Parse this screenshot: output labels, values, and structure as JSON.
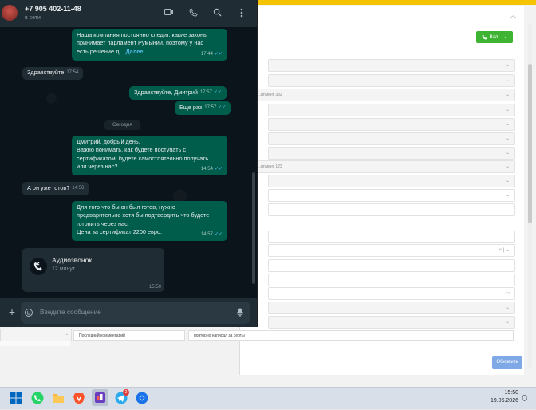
{
  "crm": {
    "call_button_label": "Вал",
    "save_button_label": "Обновить",
    "row_texts": [
      "...ипмент 332",
      "...ипмент 123"
    ],
    "last_comment_label": "Последний комментарий",
    "last_comment_value": "повторно написал за серты"
  },
  "whatsapp": {
    "contact_name": "+7 905 402-11-48",
    "contact_status": "в сети",
    "date_separator": "Сегодня",
    "messages": [
      {
        "direction": "out",
        "text": "Наша компания постоянно следит, какие законы\nпринимает парламент Румынии, поэтому у нас\nесть решение д...",
        "more": "Далее",
        "time": "17:44"
      },
      {
        "direction": "in",
        "text": "Здравствуйте",
        "time": "17:54"
      },
      {
        "direction": "out",
        "text": "Здравствуйте, Дмитрий",
        "time": "17:57"
      },
      {
        "direction": "out",
        "text": "Еще раз",
        "time": "17:57"
      },
      {
        "direction": "out",
        "text": "Дмитрий, добрый день.\nВажно понимать, как будете поступать с\nсертификатом, будете самостоятельно получать\nили через нас?",
        "time": "14:54"
      },
      {
        "direction": "in",
        "text": "А он уже готов?",
        "time": "14:56"
      },
      {
        "direction": "out",
        "text": "Для того что бы он был готов, нужно\nпредварительно хотя бы подтвердить что будете\nготовить через нас.\nЦена за сертификат 2200 евро.",
        "time": "14:57"
      }
    ],
    "call": {
      "title": "Аудиозвонок",
      "subtitle": "12 минут",
      "time": "15:50"
    },
    "composer_placeholder": "Введите сообщение"
  },
  "taskbar": {
    "time": "15:50",
    "date": "19.05.2026",
    "telegram_badge": "2"
  },
  "colors": {
    "wa_bg": "#0b141a",
    "wa_out_bubble": "#005c4b",
    "wa_in_bubble": "#202c33",
    "crm_accent_yellow": "#f5c400",
    "crm_green_button": "#3fb332",
    "crm_blue_button": "#7fa9e6"
  }
}
